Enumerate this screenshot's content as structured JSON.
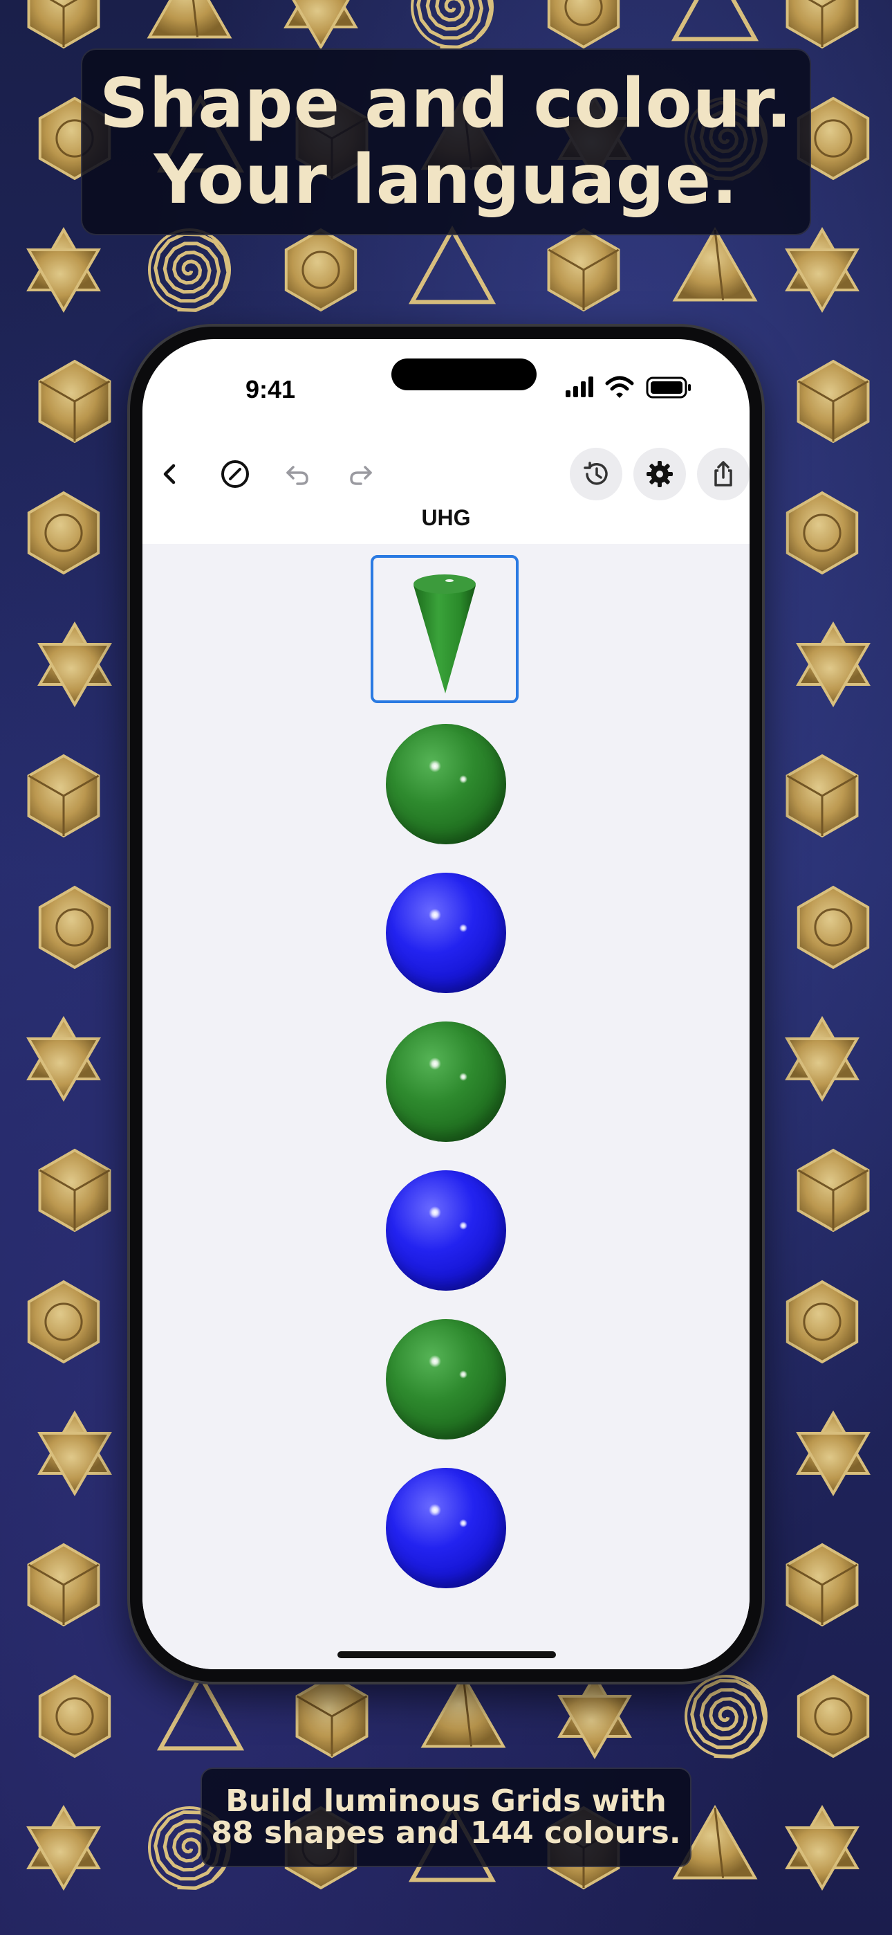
{
  "headline": {
    "line1": "Shape and colour.",
    "line2": "Your language."
  },
  "caption": {
    "line1": "Build luminous Grids with",
    "line2": "88 shapes and 144 colours."
  },
  "status_bar": {
    "time": "9:41"
  },
  "toolbar": {
    "back_icon": "chevron-left-icon",
    "clear_icon": "slash-circle-icon",
    "undo_icon": "undo-icon",
    "redo_icon": "redo-icon",
    "history_icon": "history-icon",
    "settings_icon": "gear-icon",
    "share_icon": "share-icon"
  },
  "nav": {
    "title": "UHG"
  },
  "grid": {
    "selected_item": {
      "shape": "cone",
      "color": "green"
    },
    "items": [
      {
        "shape": "sphere",
        "color": "green"
      },
      {
        "shape": "sphere",
        "color": "blue"
      },
      {
        "shape": "sphere",
        "color": "green"
      },
      {
        "shape": "sphere",
        "color": "blue"
      },
      {
        "shape": "sphere",
        "color": "green"
      },
      {
        "shape": "sphere",
        "color": "blue"
      }
    ]
  },
  "colors": {
    "gold": "#d4b56a",
    "headline_text": "#f1e4c4",
    "selection": "#2a7ae2",
    "green": "#2e8a2e",
    "blue": "#2323f0"
  }
}
